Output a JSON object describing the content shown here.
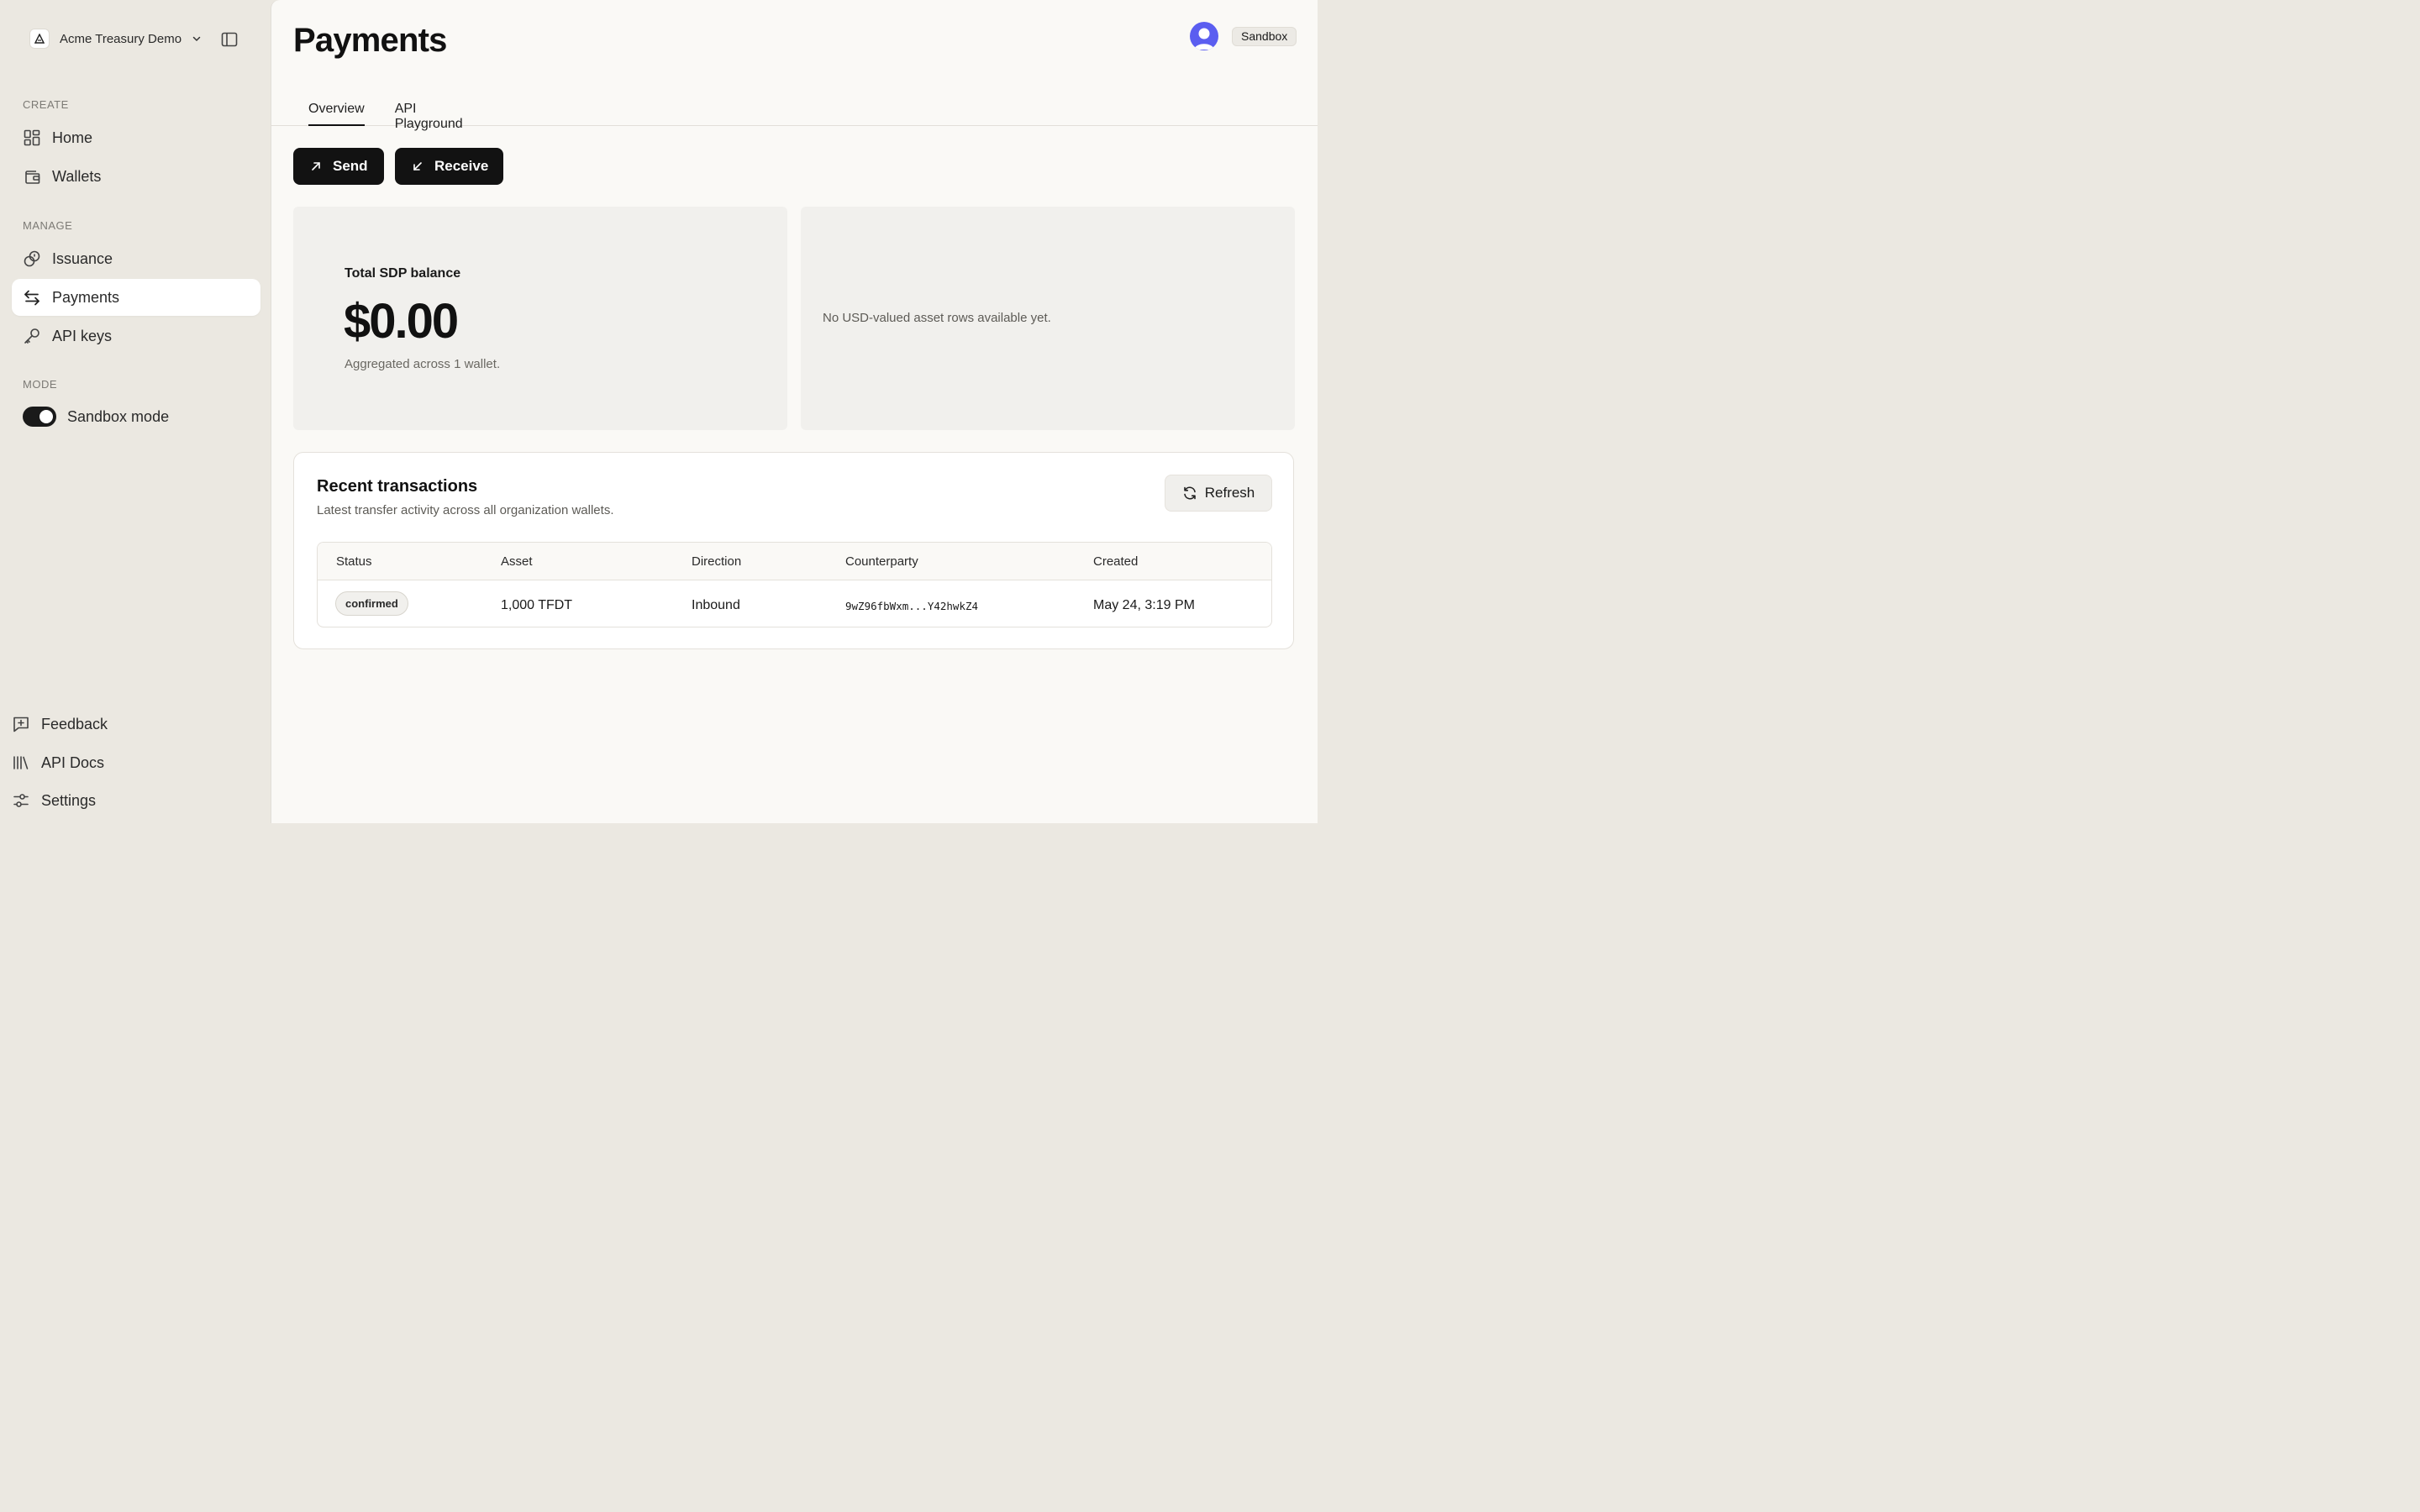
{
  "sidebar": {
    "org_name": "Acme Treasury Demo",
    "sections": {
      "create": "CREATE",
      "manage": "MANAGE",
      "mode": "MODE"
    },
    "items": {
      "home": "Home",
      "wallets": "Wallets",
      "issuance": "Issuance",
      "payments": "Payments",
      "api_keys": "API keys"
    },
    "active_item": "payments",
    "sandbox_toggle": {
      "label": "Sandbox mode",
      "on": true
    },
    "footer": {
      "feedback": "Feedback",
      "api_docs": "API Docs",
      "settings": "Settings"
    },
    "icons": {
      "org_logo": "delta-logo",
      "org_chevron": "chevron-down-icon",
      "collapse": "sidebar-panel-icon",
      "home": "grid-icon",
      "wallets": "wallet-icon",
      "issuance": "coins-icon",
      "payments": "arrows-left-right-icon",
      "api_keys": "key-icon",
      "feedback": "message-plus-icon",
      "api_docs": "library-icon",
      "settings": "sliders-icon"
    }
  },
  "header": {
    "title": "Payments",
    "environment_badge": "Sandbox",
    "avatar": "user-avatar"
  },
  "tabs": [
    {
      "label": "Overview",
      "active": true
    },
    {
      "label": "API Playground",
      "active": false
    }
  ],
  "actions": {
    "send": "Send",
    "receive": "Receive"
  },
  "balance_card": {
    "label": "Total SDP balance",
    "value": "$0.00",
    "subtext": "Aggregated across 1 wallet."
  },
  "assets_card": {
    "empty_text": "No USD-valued asset rows available yet."
  },
  "transactions": {
    "title": "Recent transactions",
    "subtitle": "Latest transfer activity across all organization wallets.",
    "refresh_label": "Refresh",
    "columns": [
      "Status",
      "Asset",
      "Direction",
      "Counterparty",
      "Created"
    ],
    "rows": [
      {
        "status": "confirmed",
        "asset": "1,000 TFDT",
        "direction": "Inbound",
        "counterparty": "9wZ96fbWxm...Y42hwkZ4",
        "created": "May 24, 3:19 PM"
      }
    ]
  },
  "colors": {
    "sidebar_bg": "#ebe8e1",
    "main_bg": "#faf9f6",
    "primary_button": "#121212",
    "avatar": "#5b5ef0",
    "card_gray": "#f1f0ed"
  }
}
